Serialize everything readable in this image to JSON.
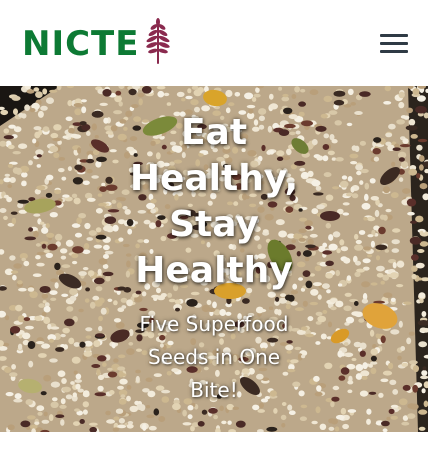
{
  "header": {
    "brand": "NICTE",
    "logo_icon": "amaranth-plant-icon",
    "menu_icon": "hamburger-menu-icon",
    "brand_color": "#0d7a34",
    "logo_color": "#8a2a4e"
  },
  "hero": {
    "title_lines": [
      "Eat",
      "Healthy,",
      "Stay",
      "Healthy"
    ],
    "subtitle_lines": [
      "Five Superfood",
      "Seeds in One",
      "Bite!"
    ],
    "background_image": "mixed superfood seeds"
  }
}
